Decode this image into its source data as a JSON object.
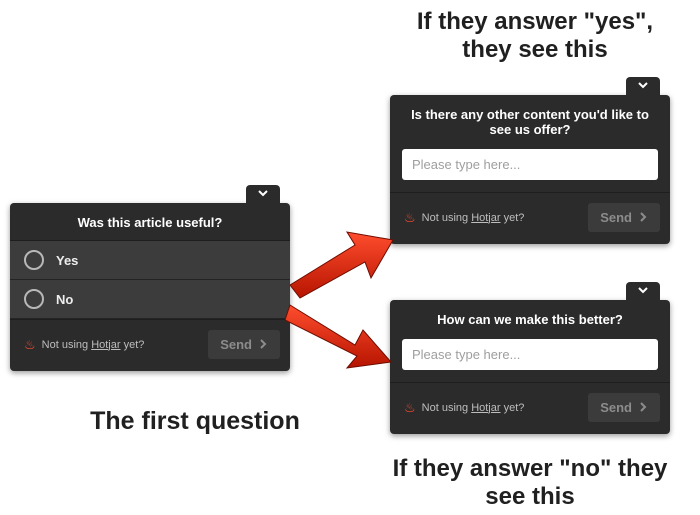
{
  "captions": {
    "top": "If they answer \"yes\", they see this",
    "left": "The first question",
    "bottom": "If they answer \"no\" they see this"
  },
  "poll1": {
    "title": "Was this article useful?",
    "options": [
      "Yes",
      "No"
    ],
    "promo_prefix": "Not using ",
    "promo_brand": "Hotjar",
    "promo_suffix": " yet?",
    "send_label": "Send"
  },
  "poll2": {
    "title": "Is there any other content you'd like to see us offer?",
    "placeholder": "Please type here...",
    "promo_prefix": "Not using ",
    "promo_brand": "Hotjar",
    "promo_suffix": " yet?",
    "send_label": "Send"
  },
  "poll3": {
    "title": "How can we make this better?",
    "placeholder": "Please type here...",
    "promo_prefix": "Not using ",
    "promo_brand": "Hotjar",
    "promo_suffix": " yet?",
    "send_label": "Send"
  }
}
